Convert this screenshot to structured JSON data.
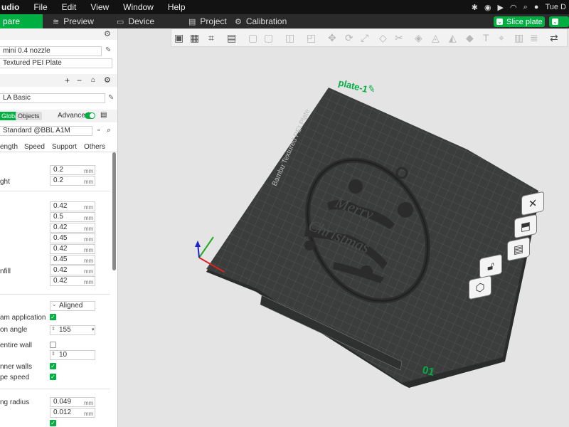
{
  "menubar": {
    "app": "udio",
    "items": [
      "File",
      "Edit",
      "View",
      "Window",
      "Help"
    ],
    "clock": "Tue D"
  },
  "tabs": {
    "prepare": "pare",
    "preview": "Preview",
    "device": "Device",
    "project": "Project",
    "calibration": "Calibration",
    "slice_button": "Slice plate"
  },
  "printer": {
    "name": "mini 0.4 nozzle",
    "plate": "Textured PEI Plate"
  },
  "filament": {
    "name": "LA Basic"
  },
  "process": {
    "global_tab": "Global",
    "objects_tab": "Objects",
    "advanced_label": "Advanced",
    "preset": "Standard @BBL A1M",
    "subtabs": [
      "ength",
      "Speed",
      "Support",
      "Others"
    ]
  },
  "settings": {
    "unit": "mm",
    "layer_height_values": [
      {
        "label": "",
        "value": "0.2"
      },
      {
        "label": "ght",
        "value": "0.2"
      }
    ],
    "line_width_values": [
      {
        "label": "",
        "value": "0.42"
      },
      {
        "label": "",
        "value": "0.5"
      },
      {
        "label": "",
        "value": "0.42"
      },
      {
        "label": "",
        "value": "0.45"
      },
      {
        "label": "",
        "value": "0.42"
      },
      {
        "label": "",
        "value": "0.45"
      },
      {
        "label": "nfill",
        "value": "0.42"
      },
      {
        "label": "",
        "value": "0.42"
      }
    ],
    "seam_position": "Aligned",
    "seam_application_label": "am application",
    "seam_application_checked": true,
    "angle_label": "on angle",
    "angle_value": "155",
    "entire_wall_label": "entire wall",
    "entire_wall_checked": false,
    "wall_count_value": "10",
    "inner_walls_label": "nner walls",
    "inner_walls_checked": true,
    "wipe_speed_label": "pe speed",
    "wipe_speed_checked": true,
    "radius_label": "ng radius",
    "radius_value": "0.049",
    "second_value": "0.012",
    "last_checked": true
  },
  "scene": {
    "plate_label": "plate-1",
    "plate_number": "01",
    "bed_text": "Bambu Textured PEI Plate",
    "model_text_1": "Merry",
    "model_text_2": "Christmas"
  },
  "colors": {
    "accent": "#00ae42",
    "bed": "#3b3d3c",
    "grid": "#575958"
  },
  "icons": {
    "nav_prepare": "cube-icon",
    "nav_preview": "layers-icon",
    "nav_device": "monitor-icon",
    "nav_project": "project-icon",
    "nav_calibration": "gear-icon"
  }
}
